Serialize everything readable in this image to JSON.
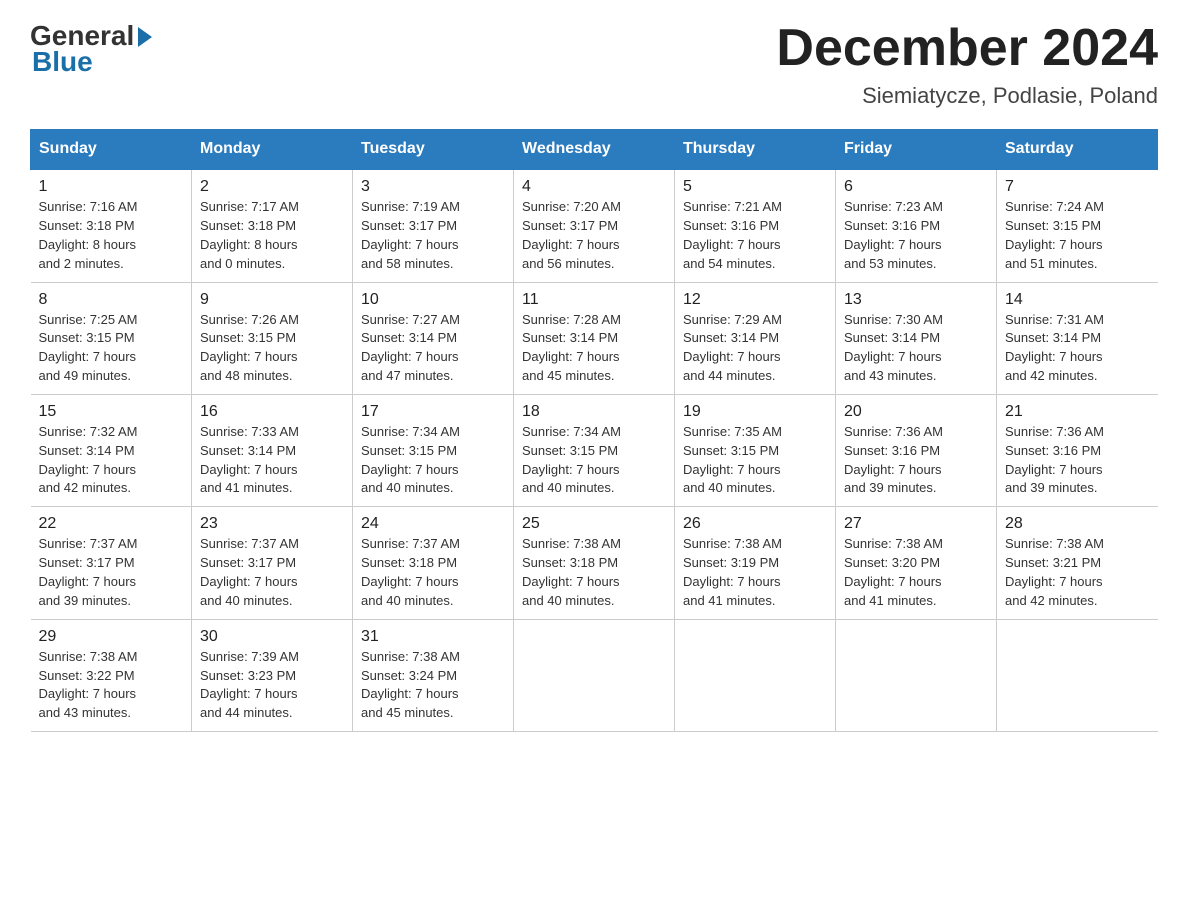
{
  "header": {
    "logo": {
      "general": "General",
      "blue": "Blue"
    },
    "title": "December 2024",
    "location": "Siemiatycze, Podlasie, Poland"
  },
  "columns": [
    "Sunday",
    "Monday",
    "Tuesday",
    "Wednesday",
    "Thursday",
    "Friday",
    "Saturday"
  ],
  "weeks": [
    [
      {
        "day": "1",
        "sunrise": "Sunrise: 7:16 AM",
        "sunset": "Sunset: 3:18 PM",
        "daylight": "Daylight: 8 hours",
        "daylight2": "and 2 minutes."
      },
      {
        "day": "2",
        "sunrise": "Sunrise: 7:17 AM",
        "sunset": "Sunset: 3:18 PM",
        "daylight": "Daylight: 8 hours",
        "daylight2": "and 0 minutes."
      },
      {
        "day": "3",
        "sunrise": "Sunrise: 7:19 AM",
        "sunset": "Sunset: 3:17 PM",
        "daylight": "Daylight: 7 hours",
        "daylight2": "and 58 minutes."
      },
      {
        "day": "4",
        "sunrise": "Sunrise: 7:20 AM",
        "sunset": "Sunset: 3:17 PM",
        "daylight": "Daylight: 7 hours",
        "daylight2": "and 56 minutes."
      },
      {
        "day": "5",
        "sunrise": "Sunrise: 7:21 AM",
        "sunset": "Sunset: 3:16 PM",
        "daylight": "Daylight: 7 hours",
        "daylight2": "and 54 minutes."
      },
      {
        "day": "6",
        "sunrise": "Sunrise: 7:23 AM",
        "sunset": "Sunset: 3:16 PM",
        "daylight": "Daylight: 7 hours",
        "daylight2": "and 53 minutes."
      },
      {
        "day": "7",
        "sunrise": "Sunrise: 7:24 AM",
        "sunset": "Sunset: 3:15 PM",
        "daylight": "Daylight: 7 hours",
        "daylight2": "and 51 minutes."
      }
    ],
    [
      {
        "day": "8",
        "sunrise": "Sunrise: 7:25 AM",
        "sunset": "Sunset: 3:15 PM",
        "daylight": "Daylight: 7 hours",
        "daylight2": "and 49 minutes."
      },
      {
        "day": "9",
        "sunrise": "Sunrise: 7:26 AM",
        "sunset": "Sunset: 3:15 PM",
        "daylight": "Daylight: 7 hours",
        "daylight2": "and 48 minutes."
      },
      {
        "day": "10",
        "sunrise": "Sunrise: 7:27 AM",
        "sunset": "Sunset: 3:14 PM",
        "daylight": "Daylight: 7 hours",
        "daylight2": "and 47 minutes."
      },
      {
        "day": "11",
        "sunrise": "Sunrise: 7:28 AM",
        "sunset": "Sunset: 3:14 PM",
        "daylight": "Daylight: 7 hours",
        "daylight2": "and 45 minutes."
      },
      {
        "day": "12",
        "sunrise": "Sunrise: 7:29 AM",
        "sunset": "Sunset: 3:14 PM",
        "daylight": "Daylight: 7 hours",
        "daylight2": "and 44 minutes."
      },
      {
        "day": "13",
        "sunrise": "Sunrise: 7:30 AM",
        "sunset": "Sunset: 3:14 PM",
        "daylight": "Daylight: 7 hours",
        "daylight2": "and 43 minutes."
      },
      {
        "day": "14",
        "sunrise": "Sunrise: 7:31 AM",
        "sunset": "Sunset: 3:14 PM",
        "daylight": "Daylight: 7 hours",
        "daylight2": "and 42 minutes."
      }
    ],
    [
      {
        "day": "15",
        "sunrise": "Sunrise: 7:32 AM",
        "sunset": "Sunset: 3:14 PM",
        "daylight": "Daylight: 7 hours",
        "daylight2": "and 42 minutes."
      },
      {
        "day": "16",
        "sunrise": "Sunrise: 7:33 AM",
        "sunset": "Sunset: 3:14 PM",
        "daylight": "Daylight: 7 hours",
        "daylight2": "and 41 minutes."
      },
      {
        "day": "17",
        "sunrise": "Sunrise: 7:34 AM",
        "sunset": "Sunset: 3:15 PM",
        "daylight": "Daylight: 7 hours",
        "daylight2": "and 40 minutes."
      },
      {
        "day": "18",
        "sunrise": "Sunrise: 7:34 AM",
        "sunset": "Sunset: 3:15 PM",
        "daylight": "Daylight: 7 hours",
        "daylight2": "and 40 minutes."
      },
      {
        "day": "19",
        "sunrise": "Sunrise: 7:35 AM",
        "sunset": "Sunset: 3:15 PM",
        "daylight": "Daylight: 7 hours",
        "daylight2": "and 40 minutes."
      },
      {
        "day": "20",
        "sunrise": "Sunrise: 7:36 AM",
        "sunset": "Sunset: 3:16 PM",
        "daylight": "Daylight: 7 hours",
        "daylight2": "and 39 minutes."
      },
      {
        "day": "21",
        "sunrise": "Sunrise: 7:36 AM",
        "sunset": "Sunset: 3:16 PM",
        "daylight": "Daylight: 7 hours",
        "daylight2": "and 39 minutes."
      }
    ],
    [
      {
        "day": "22",
        "sunrise": "Sunrise: 7:37 AM",
        "sunset": "Sunset: 3:17 PM",
        "daylight": "Daylight: 7 hours",
        "daylight2": "and 39 minutes."
      },
      {
        "day": "23",
        "sunrise": "Sunrise: 7:37 AM",
        "sunset": "Sunset: 3:17 PM",
        "daylight": "Daylight: 7 hours",
        "daylight2": "and 40 minutes."
      },
      {
        "day": "24",
        "sunrise": "Sunrise: 7:37 AM",
        "sunset": "Sunset: 3:18 PM",
        "daylight": "Daylight: 7 hours",
        "daylight2": "and 40 minutes."
      },
      {
        "day": "25",
        "sunrise": "Sunrise: 7:38 AM",
        "sunset": "Sunset: 3:18 PM",
        "daylight": "Daylight: 7 hours",
        "daylight2": "and 40 minutes."
      },
      {
        "day": "26",
        "sunrise": "Sunrise: 7:38 AM",
        "sunset": "Sunset: 3:19 PM",
        "daylight": "Daylight: 7 hours",
        "daylight2": "and 41 minutes."
      },
      {
        "day": "27",
        "sunrise": "Sunrise: 7:38 AM",
        "sunset": "Sunset: 3:20 PM",
        "daylight": "Daylight: 7 hours",
        "daylight2": "and 41 minutes."
      },
      {
        "day": "28",
        "sunrise": "Sunrise: 7:38 AM",
        "sunset": "Sunset: 3:21 PM",
        "daylight": "Daylight: 7 hours",
        "daylight2": "and 42 minutes."
      }
    ],
    [
      {
        "day": "29",
        "sunrise": "Sunrise: 7:38 AM",
        "sunset": "Sunset: 3:22 PM",
        "daylight": "Daylight: 7 hours",
        "daylight2": "and 43 minutes."
      },
      {
        "day": "30",
        "sunrise": "Sunrise: 7:39 AM",
        "sunset": "Sunset: 3:23 PM",
        "daylight": "Daylight: 7 hours",
        "daylight2": "and 44 minutes."
      },
      {
        "day": "31",
        "sunrise": "Sunrise: 7:38 AM",
        "sunset": "Sunset: 3:24 PM",
        "daylight": "Daylight: 7 hours",
        "daylight2": "and 45 minutes."
      },
      null,
      null,
      null,
      null
    ]
  ]
}
